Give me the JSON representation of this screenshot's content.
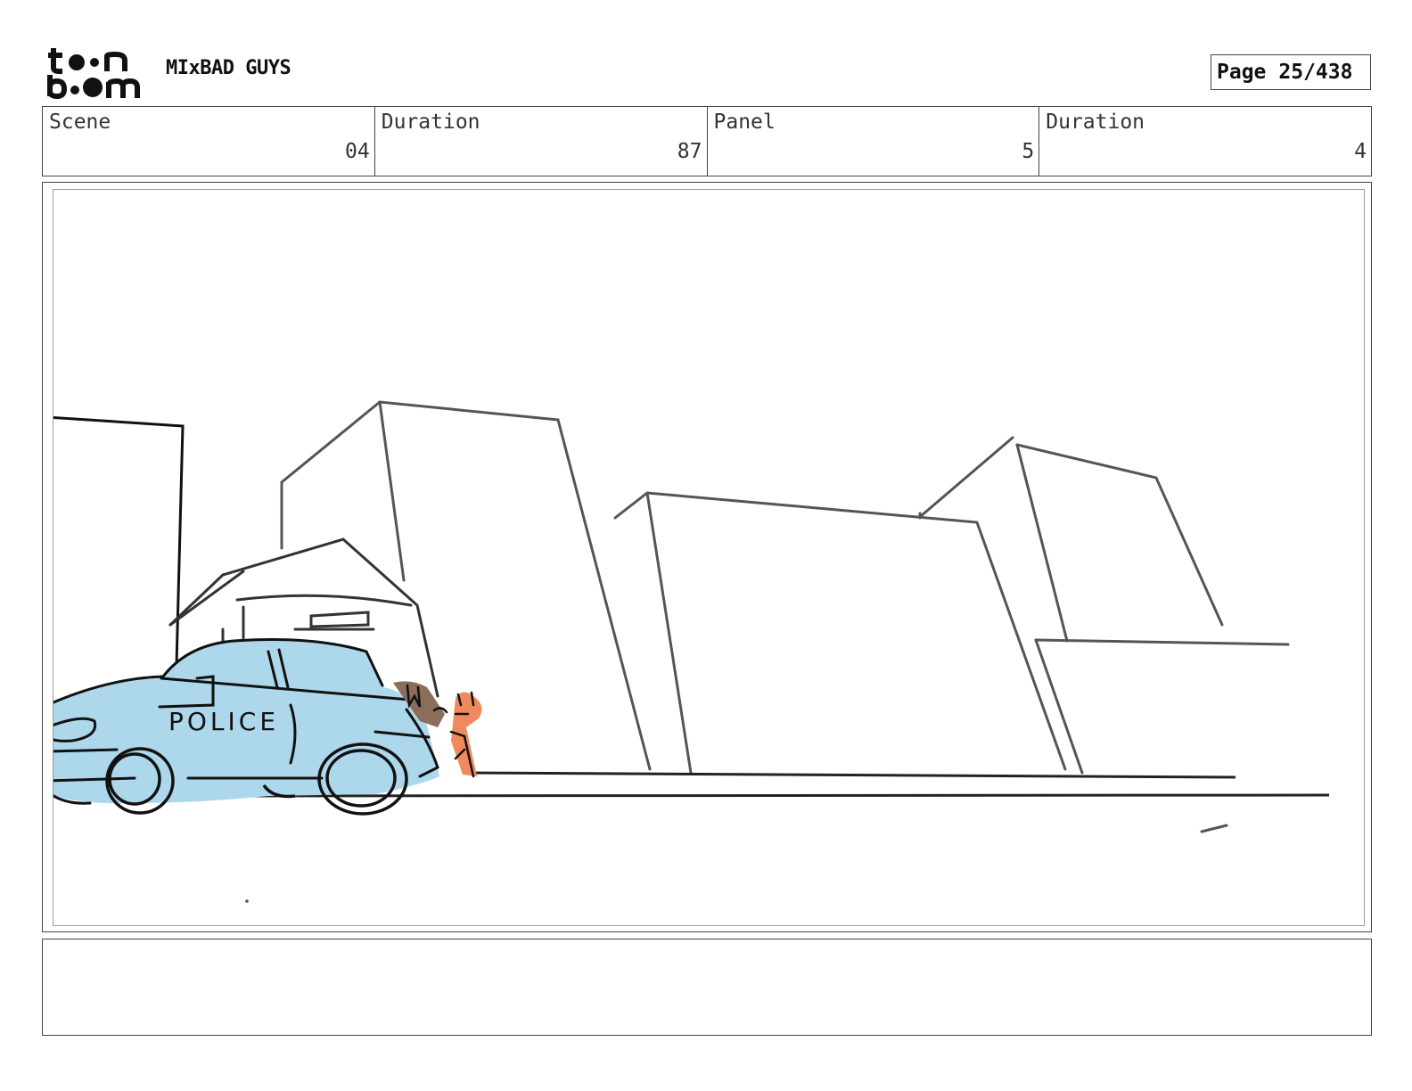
{
  "header": {
    "logo_text": "toon boom",
    "project_title": "MIxBAD GUYS",
    "page_label": "Page",
    "page_number": "25/438"
  },
  "info": {
    "scene_label": "Scene",
    "scene_value": "04",
    "scene_duration_label": "Duration",
    "scene_duration_value": "87",
    "panel_label": "Panel",
    "panel_value": "5",
    "panel_duration_label": "Duration",
    "panel_duration_value": "4"
  },
  "panel": {
    "car_lettering": "POLICE",
    "colors": {
      "car_fill": "#add8eb",
      "character_orange": "#f08a5d",
      "character_brown": "#8a6d5a",
      "building_lines": "#666666",
      "ink": "#1a1a1a"
    }
  },
  "notes": {
    "text": ""
  }
}
